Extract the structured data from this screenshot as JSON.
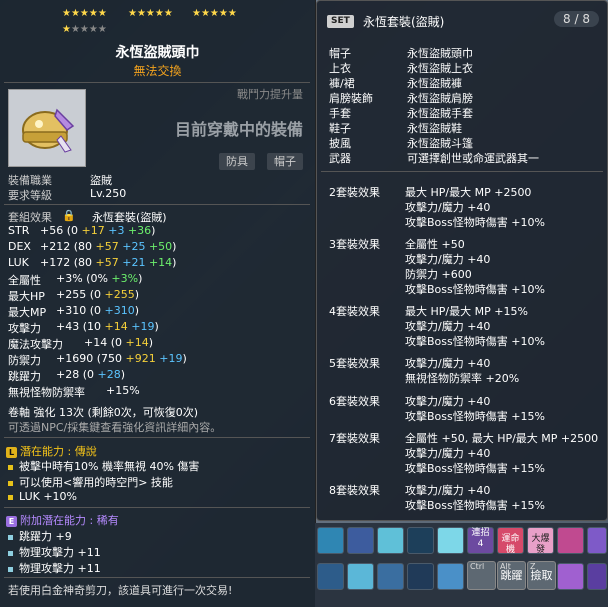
{
  "item": {
    "stars_filled": "★★★★★ ★★★★★ ★★★★★ ★",
    "star_group_1": "★★★★★",
    "star_group_2": "★★★★★",
    "star_group_3": "★★★★★",
    "star_group_4_filled": "★",
    "star_group_4_empty": "★★★★",
    "title": "永恆盜賊頭巾",
    "tradable": "無法交換",
    "power_label": "戰鬥力提升量",
    "wearing": "目前穿戴中的裝備",
    "tags": [
      "防具",
      "帽子"
    ],
    "job_label": "裝備職業",
    "job_value": "盜賊",
    "level_label": "要求等級",
    "level_value": "Lv.250",
    "set_label": "套組效果",
    "set_value": "永恆套裝(盜賊)",
    "stats": [
      {
        "name": "STR",
        "total": "+56",
        "base": "0",
        "a": "+17",
        "b": "+3",
        "c": "+36"
      },
      {
        "name": "DEX",
        "total": "+212",
        "base": "80",
        "a": "+57",
        "b": "+25",
        "c": "+50"
      },
      {
        "name": "LUK",
        "total": "+172",
        "base": "80",
        "a": "+57",
        "b": "+21",
        "c": "+14"
      }
    ],
    "allstat": {
      "name": "全屬性",
      "total": "+3%",
      "base": "0%",
      "c": "+3%"
    },
    "hp": {
      "name": "最大HP",
      "total": "+255",
      "base": "0",
      "c": "+255"
    },
    "mp": {
      "name": "最大MP",
      "total": "+310",
      "base": "0",
      "c": "+310"
    },
    "atk": {
      "name": "攻擊力",
      "total": "+43",
      "base": "10",
      "a": "+14",
      "b": "+19"
    },
    "matk": {
      "name": "魔法攻擊力",
      "total": "+14",
      "base": "0",
      "a": "+14"
    },
    "def": {
      "name": "防禦力",
      "total": "+1690",
      "base": "750",
      "a": "+921",
      "b": "+19"
    },
    "jump": {
      "name": "跳躍力",
      "total": "+28",
      "base": "0",
      "b": "+28"
    },
    "ignore": {
      "name": "無視怪物防禦率",
      "total": "+15%"
    },
    "scroll": "卷軸 強化 13次 (剩餘0次，可恢復0次)",
    "scroll_note": "可透過NPC/採集鍵查看強化資訊詳細內容。",
    "potential_title": "潛在能力 : 傳說",
    "potential_lines": [
      "被擊中時有10% 機率無視 40% 傷害",
      "可以使用<響用的時空門> 技能",
      "LUK +10%"
    ],
    "addpot_title": "附加潛在能力 : 稀有",
    "addpot_lines": [
      "跳躍力 +9",
      "物理攻擊力 +11",
      "物理攻擊力 +11"
    ],
    "footer": "若使用白金神奇剪刀，該道具可進行一次交易!"
  },
  "set": {
    "badge": "SET",
    "title": "永恆套裝(盜賊)",
    "count": "8 / 8",
    "parts": [
      {
        "slot": "帽子",
        "name": "永恆盜賊頭巾"
      },
      {
        "slot": "上衣",
        "name": "永恆盜賊上衣"
      },
      {
        "slot": "褲/裙",
        "name": "永恆盜賊褲"
      },
      {
        "slot": "肩膀裝飾",
        "name": "永恆盜賊肩膀"
      },
      {
        "slot": "手套",
        "name": "永恆盜賊手套"
      },
      {
        "slot": "鞋子",
        "name": "永恆盜賊鞋"
      },
      {
        "slot": "披風",
        "name": "永恆盜賊斗篷"
      },
      {
        "slot": "武器",
        "name": "可選擇創世或命運武器其一"
      }
    ],
    "effects": [
      {
        "label": "2套裝效果",
        "lines": [
          "最大 HP/最大 MP +2500",
          "攻擊力/魔力 +40",
          "攻擊Boss怪物時傷害 +10%"
        ]
      },
      {
        "label": "3套裝效果",
        "lines": [
          "全屬性 +50",
          "攻擊力/魔力 +40",
          "防禦力 +600",
          "攻擊Boss怪物時傷害 +10%"
        ]
      },
      {
        "label": "4套裝效果",
        "lines": [
          "最大 HP/最大 MP +15%",
          "攻擊力/魔力 +40",
          "攻擊Boss怪物時傷害 +10%"
        ]
      },
      {
        "label": "5套裝效果",
        "lines": [
          "攻擊力/魔力 +40",
          "無視怪物防禦率 +20%"
        ]
      },
      {
        "label": "6套裝效果",
        "lines": [
          "攻擊力/魔力 +40",
          "攻擊Boss怪物時傷害 +15%"
        ]
      },
      {
        "label": "7套裝效果",
        "lines": [
          "全屬性 +50, 最大 HP/最大 MP +2500",
          "攻擊力/魔力 +40",
          "攻擊Boss怪物時傷害 +15%"
        ]
      },
      {
        "label": "8套裝效果",
        "lines": [
          "攻擊力/魔力 +40",
          "攻擊Boss怪物時傷害 +15%"
        ]
      }
    ]
  },
  "hotbar": {
    "k1_text": "連招",
    "k1_num": "4",
    "k2_text": "運命機",
    "k3_text": "大爆發",
    "jump_key": "Alt",
    "jump_label": "跳躍",
    "pick_key": "Z",
    "pick_label": "撿取",
    "ctrl_key": "Ctrl"
  },
  "colors": {
    "star": "#ffd84a",
    "tradable": "#f2a21e",
    "bonus_yellow": "#f5d03a",
    "bonus_blue": "#5bc4ff",
    "bonus_green": "#6cf06c"
  }
}
